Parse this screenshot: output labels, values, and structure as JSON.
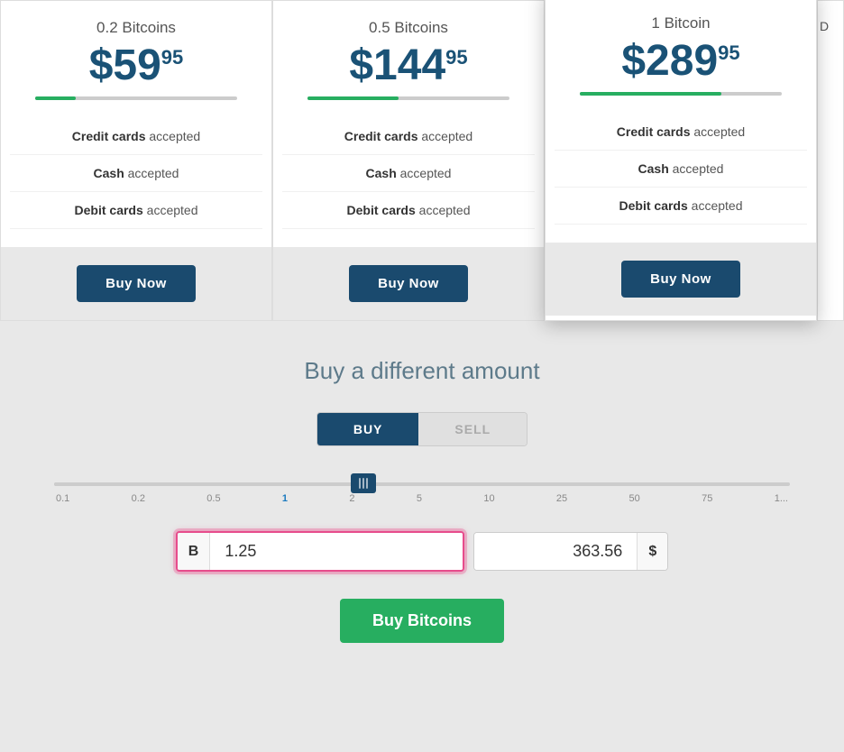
{
  "pricing": {
    "cards": [
      {
        "id": "card1",
        "amount": "0.2 Bitcoins",
        "price_main": "$59",
        "price_cents": "95",
        "bar_pct": "20%",
        "features": [
          {
            "label": "Credit cards",
            "suffix": "accepted"
          },
          {
            "label": "Cash",
            "suffix": "accepted"
          },
          {
            "label": "Debit cards",
            "suffix": "accepted"
          }
        ],
        "buy_label": "Buy Now",
        "featured": false
      },
      {
        "id": "card2",
        "amount": "0.5 Bitcoins",
        "price_main": "$144",
        "price_cents": "95",
        "bar_pct": "45%",
        "features": [
          {
            "label": "Credit cards",
            "suffix": "accepted"
          },
          {
            "label": "Cash",
            "suffix": "accepted"
          },
          {
            "label": "Debit cards",
            "suffix": "accepted"
          }
        ],
        "buy_label": "Buy Now",
        "featured": false
      },
      {
        "id": "card3",
        "amount": "1 Bitcoin",
        "price_main": "$289",
        "price_cents": "95",
        "bar_pct": "70%",
        "features": [
          {
            "label": "Credit cards",
            "suffix": "accepted"
          },
          {
            "label": "Cash",
            "suffix": "accepted"
          },
          {
            "label": "Debit cards",
            "suffix": "accepted"
          }
        ],
        "buy_label": "Buy Now",
        "featured": true
      }
    ],
    "partial_label": "D"
  },
  "buy_different": {
    "title": "Buy a different amount",
    "toggle": {
      "buy_label": "BUY",
      "sell_label": "SELL"
    },
    "slider": {
      "labels": [
        "0.1",
        "0.2",
        "0.5",
        "1",
        "2",
        "5",
        "10",
        "25",
        "50",
        "75",
        "1..."
      ],
      "active_label": "1"
    },
    "bitcoin_input": {
      "symbol": "B",
      "value": "1.25",
      "placeholder": "1.25"
    },
    "usd_input": {
      "value": "363.56",
      "symbol": "$"
    },
    "buy_button": "Buy Bitcoins"
  }
}
